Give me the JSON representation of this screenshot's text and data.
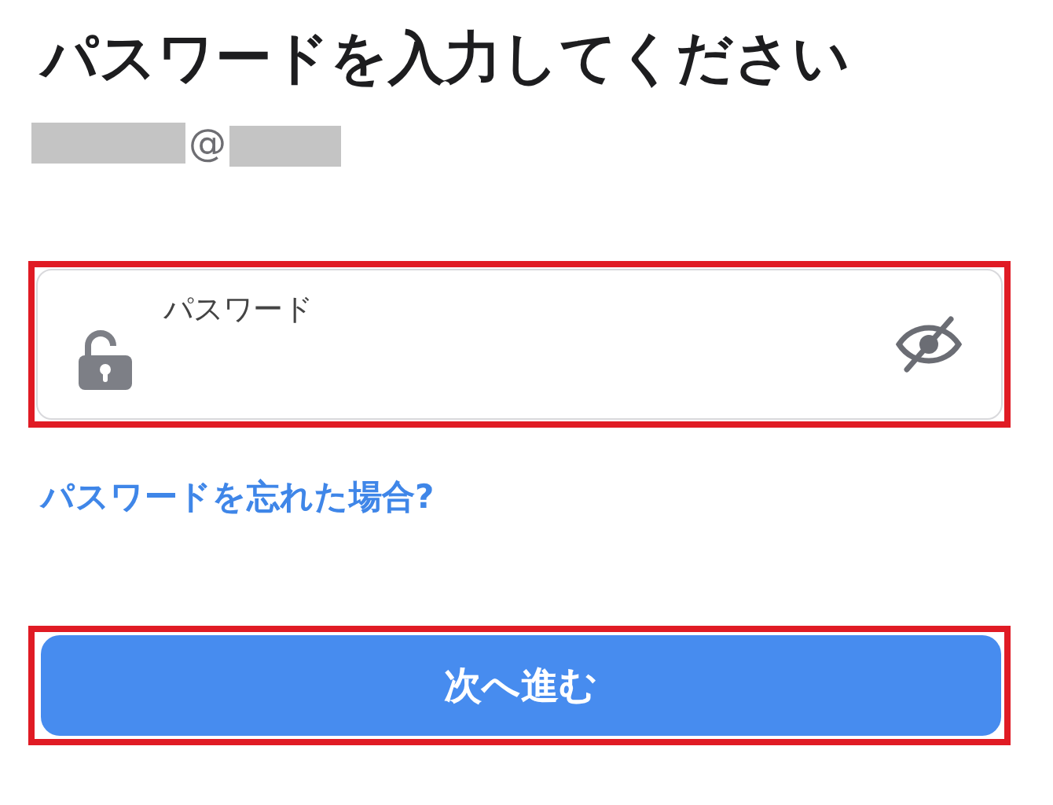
{
  "title": "パスワードを入力してください",
  "account": {
    "at": "@"
  },
  "password_field": {
    "placeholder": "パスワード",
    "masked": true
  },
  "forgot_link": "パスワードを忘れた場合?",
  "next_button": "次へ進む"
}
